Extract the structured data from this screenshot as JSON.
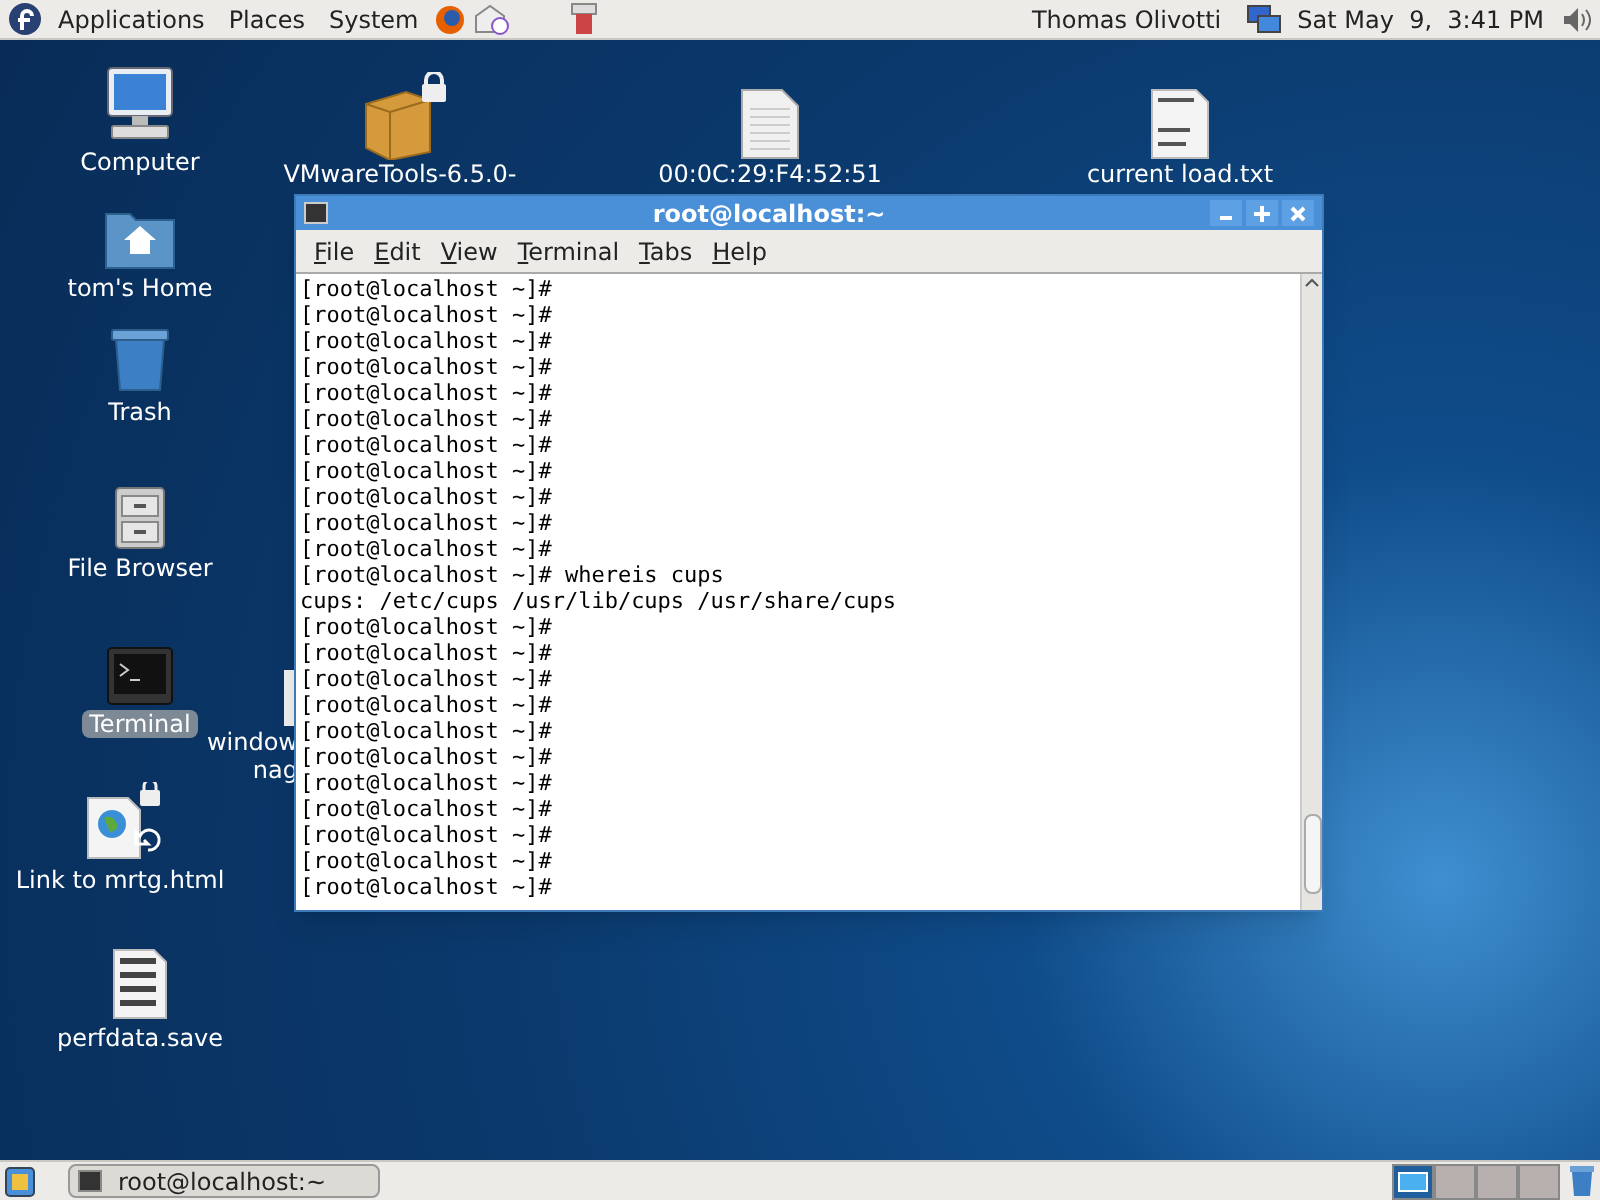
{
  "top_panel": {
    "menus": [
      "Applications",
      "Places",
      "System"
    ],
    "user": "Thomas Olivotti",
    "clock": "Sat May  9,  3:41 PM"
  },
  "desktop_icons": [
    {
      "kind": "computer",
      "label": "Computer",
      "selected": false
    },
    {
      "kind": "home",
      "label": "tom's Home",
      "selected": false
    },
    {
      "kind": "trash",
      "label": "Trash",
      "selected": false
    },
    {
      "kind": "cabinet",
      "label": "File Browser",
      "selected": false
    },
    {
      "kind": "terminal",
      "label": "Terminal",
      "selected": true
    },
    {
      "kind": "weblink",
      "label": "Link to mrtg.html",
      "selected": false
    },
    {
      "kind": "numbers",
      "label": "perfdata.save",
      "selected": false
    }
  ],
  "top_icons": [
    {
      "kind": "package",
      "label": "VMwareTools-6.5.0-"
    },
    {
      "kind": "document",
      "label": "00:0C:29:F4:52:51"
    },
    {
      "kind": "textfile",
      "label": "current load.txt"
    }
  ],
  "hidden_icon": {
    "lines": [
      "window",
      "nag"
    ]
  },
  "terminal": {
    "title": "root@localhost:~",
    "menu": [
      "File",
      "Edit",
      "View",
      "Terminal",
      "Tabs",
      "Help"
    ],
    "lines": [
      "[root@localhost ~]#",
      "[root@localhost ~]#",
      "[root@localhost ~]#",
      "[root@localhost ~]#",
      "[root@localhost ~]#",
      "[root@localhost ~]#",
      "[root@localhost ~]#",
      "[root@localhost ~]#",
      "[root@localhost ~]#",
      "[root@localhost ~]#",
      "[root@localhost ~]#",
      "[root@localhost ~]# whereis cups",
      "cups: /etc/cups /usr/lib/cups /usr/share/cups",
      "[root@localhost ~]#",
      "[root@localhost ~]#",
      "[root@localhost ~]#",
      "[root@localhost ~]#",
      "[root@localhost ~]#",
      "[root@localhost ~]#",
      "[root@localhost ~]#",
      "[root@localhost ~]#",
      "[root@localhost ~]#",
      "[root@localhost ~]#",
      "[root@localhost ~]#"
    ]
  },
  "taskbar": {
    "windows": [
      {
        "label": "root@localhost:~"
      }
    ],
    "workspaces": [
      {
        "selected": true
      },
      {
        "selected": false
      },
      {
        "selected": false
      },
      {
        "selected": false
      }
    ]
  }
}
